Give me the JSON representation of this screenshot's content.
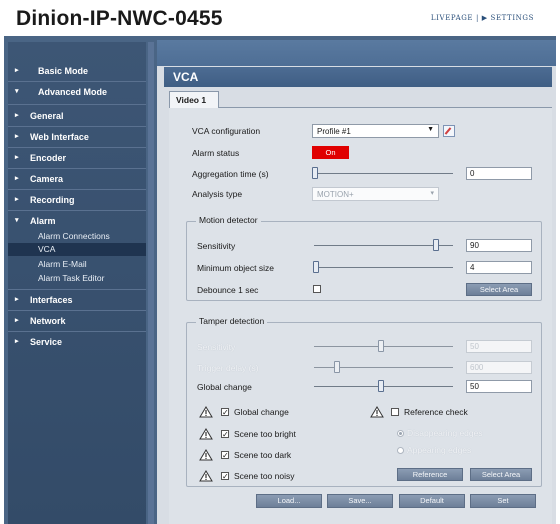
{
  "header": {
    "title": "Dinion-IP-NWC-0455",
    "link_livepage": "LIVEPAGE",
    "link_sep": " | ",
    "link_settings_arrow": "▶",
    "link_settings": " SETTINGS"
  },
  "sidebar": {
    "basic_mode": "Basic Mode",
    "advanced_mode": "Advanced Mode",
    "items": [
      "General",
      "Web Interface",
      "Encoder",
      "Camera",
      "Recording",
      "Alarm"
    ],
    "alarm_sub": [
      "Alarm Connections",
      "VCA",
      "Alarm E-Mail",
      "Alarm Task Editor"
    ],
    "items_after": [
      "Interfaces",
      "Network",
      "Service"
    ]
  },
  "main": {
    "section_title": "VCA",
    "tab": "Video 1",
    "vca_configuration_label": "VCA configuration",
    "vca_configuration_value": "Profile #1",
    "alarm_status_label": "Alarm status",
    "alarm_status_value": "On",
    "aggregation_label": "Aggregation time (s)",
    "aggregation_value": "0",
    "analysis_type_label": "Analysis type",
    "analysis_type_value": "MOTION+"
  },
  "motion": {
    "title": "Motion detector",
    "sensitivity_label": "Sensitivity",
    "sensitivity_value": "90",
    "min_object_label": "Minimum object size",
    "min_object_value": "4",
    "debounce_label": "Debounce 1 sec",
    "select_area": "Select Area"
  },
  "tamper": {
    "title": "Tamper detection",
    "sensitivity_label": "Sensitivity",
    "sensitivity_value": "50",
    "trigger_delay_label": "Trigger delay (s)",
    "trigger_delay_value": "600",
    "global_change_label": "Global change",
    "global_change_value": "50",
    "chk_global_change": "Global change",
    "chk_reference_check": "Reference check",
    "chk_scene_bright": "Scene too bright",
    "chk_scene_dark": "Scene too dark",
    "chk_scene_noisy": "Scene too noisy",
    "radio_disappearing": "Disappearing edges",
    "radio_appearing": "Appearing edges",
    "reference_btn": "Reference",
    "select_area_btn": "Select Area"
  },
  "footer_buttons": {
    "load": "Load...",
    "save": "Save...",
    "default": "Default",
    "set": "Set"
  },
  "colors": {
    "alarm_red": "#e00000",
    "sidebar_bg": "#3d5675",
    "header_band": "#4d6c93"
  }
}
